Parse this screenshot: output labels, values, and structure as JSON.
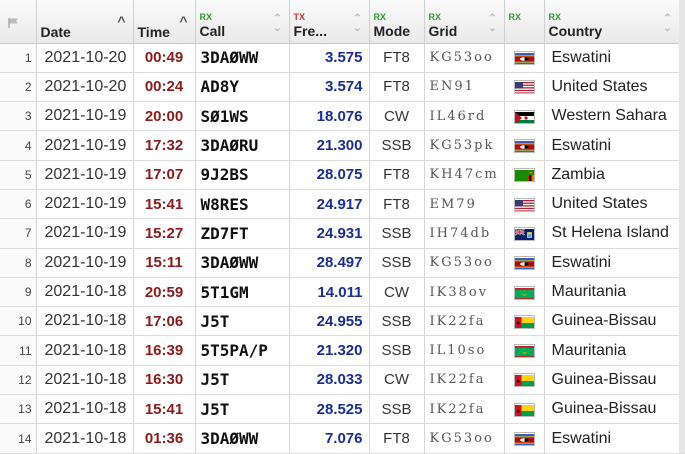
{
  "headers": {
    "date": "Date",
    "time": "Time",
    "call_sub": "RX",
    "call": "Call",
    "freq_sub": "TX",
    "freq": "Fre...",
    "mode_sub": "RX",
    "mode": "Mode",
    "grid_sub": "RX",
    "grid": "Grid",
    "flag_sub": "RX",
    "country_sub": "RX",
    "country": "Country"
  },
  "rows": [
    {
      "n": "1",
      "date": "2021-10-20",
      "time": "00:49",
      "call": "3DAØWW",
      "freq": "3.575",
      "mode": "FT8",
      "grid": "KG53oo",
      "flag": "swaziland",
      "country": "Eswatini"
    },
    {
      "n": "2",
      "date": "2021-10-20",
      "time": "00:24",
      "call": "AD8Y",
      "freq": "3.574",
      "mode": "FT8",
      "grid": "EN91",
      "flag": "usa",
      "country": "United States"
    },
    {
      "n": "3",
      "date": "2021-10-19",
      "time": "20:00",
      "call": "SØ1WS",
      "freq": "18.076",
      "mode": "CW",
      "grid": "IL46rd",
      "flag": "wsahara",
      "country": "Western Sahara"
    },
    {
      "n": "4",
      "date": "2021-10-19",
      "time": "17:32",
      "call": "3DAØRU",
      "freq": "21.300",
      "mode": "SSB",
      "grid": "KG53pk",
      "flag": "swaziland",
      "country": "Eswatini"
    },
    {
      "n": "5",
      "date": "2021-10-19",
      "time": "17:07",
      "call": "9J2BS",
      "freq": "28.075",
      "mode": "FT8",
      "grid": "KH47cm",
      "flag": "zambia",
      "country": "Zambia"
    },
    {
      "n": "6",
      "date": "2021-10-19",
      "time": "15:41",
      "call": "W8RES",
      "freq": "24.917",
      "mode": "FT8",
      "grid": "EM79",
      "flag": "usa",
      "country": "United States"
    },
    {
      "n": "7",
      "date": "2021-10-19",
      "time": "15:27",
      "call": "ZD7FT",
      "freq": "24.931",
      "mode": "SSB",
      "grid": "IH74db",
      "flag": "sthelena",
      "country": "St Helena Island"
    },
    {
      "n": "8",
      "date": "2021-10-19",
      "time": "15:11",
      "call": "3DAØWW",
      "freq": "28.497",
      "mode": "SSB",
      "grid": "KG53oo",
      "flag": "swaziland",
      "country": "Eswatini"
    },
    {
      "n": "9",
      "date": "2021-10-18",
      "time": "20:59",
      "call": "5T1GM",
      "freq": "14.011",
      "mode": "CW",
      "grid": "IK38ov",
      "flag": "mauritania",
      "country": "Mauritania"
    },
    {
      "n": "10",
      "date": "2021-10-18",
      "time": "17:06",
      "call": "J5T",
      "freq": "24.955",
      "mode": "SSB",
      "grid": "IK22fa",
      "flag": "guineabissau",
      "country": "Guinea-Bissau"
    },
    {
      "n": "11",
      "date": "2021-10-18",
      "time": "16:39",
      "call": "5T5PA/P",
      "freq": "21.320",
      "mode": "SSB",
      "grid": "IL10so",
      "flag": "mauritania",
      "country": "Mauritania"
    },
    {
      "n": "12",
      "date": "2021-10-18",
      "time": "16:30",
      "call": "J5T",
      "freq": "28.033",
      "mode": "CW",
      "grid": "IK22fa",
      "flag": "guineabissau",
      "country": "Guinea-Bissau"
    },
    {
      "n": "13",
      "date": "2021-10-18",
      "time": "15:41",
      "call": "J5T",
      "freq": "28.525",
      "mode": "SSB",
      "grid": "IK22fa",
      "flag": "guineabissau",
      "country": "Guinea-Bissau"
    },
    {
      "n": "14",
      "date": "2021-10-18",
      "time": "01:36",
      "call": "3DAØWW",
      "freq": "7.076",
      "mode": "FT8",
      "grid": "KG53oo",
      "flag": "swaziland",
      "country": "Eswatini"
    }
  ],
  "colors": {
    "time": "#8b1a1a",
    "freq": "#1a2e8f",
    "rx": "#2e9a2e",
    "tx": "#cc3333"
  }
}
